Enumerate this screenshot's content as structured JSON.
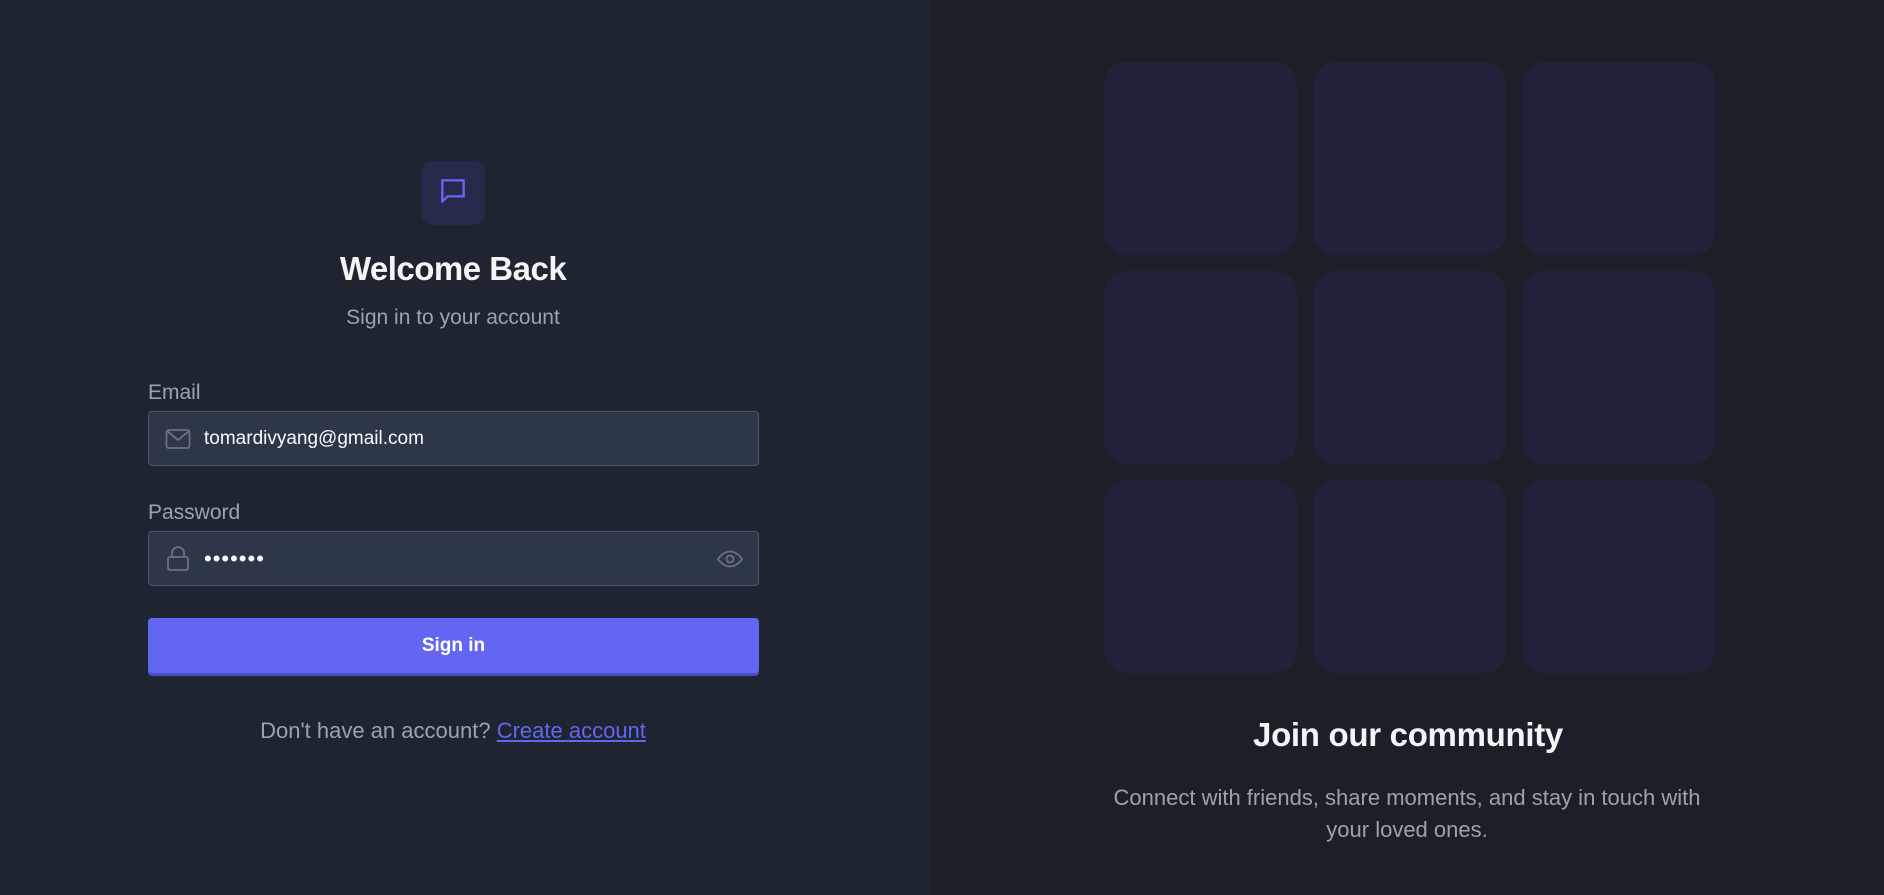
{
  "login": {
    "title": "Welcome Back",
    "subtitle": "Sign in to your account",
    "email_label": "Email",
    "email_value": "tomardivyang@gmail.com",
    "password_label": "Password",
    "password_value": "•••••••",
    "signin_label": "Sign in",
    "no_account_text": "Don't have an account?",
    "create_account_link": "Create account",
    "icons": {
      "logo": "chat-bubble-icon",
      "email": "mail-icon",
      "password": "lock-icon",
      "toggle": "eye-icon"
    }
  },
  "community": {
    "title": "Join our community",
    "description": "Connect with friends, share moments, and stay in touch with your loved ones."
  },
  "colors": {
    "accent": "#6366f1",
    "left_bg": "#1f2530",
    "right_bg": "#1b1f27",
    "tile": "#1f2238",
    "field_bg": "#2d3748"
  }
}
